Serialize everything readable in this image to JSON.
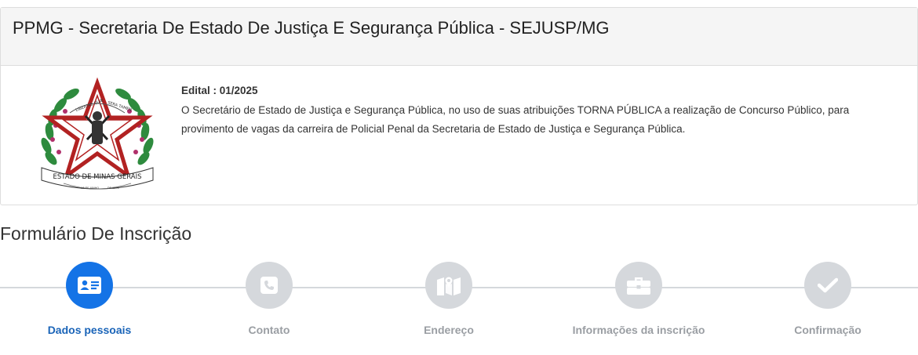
{
  "panel": {
    "title": "PPMG - Secretaria De Estado De Justiça E Segurança Pública - SEJUSP/MG",
    "crest": {
      "banner_top_left": "LIBERTAS QUÆ",
      "banner_top_right": "SERA TAMEN",
      "banner_bottom": "ESTADO DE MINAS GERAIS",
      "ribbon_left": "16 DE JUNHO",
      "ribbon_right": "DE 1891"
    },
    "edital_label": "Edital : 01/2025",
    "edital_text": "O Secretário de Estado de Justiça e Segurança Pública, no uso de suas atribuições TORNA PÚBLICA a realização de Concurso Público, para provimento de vagas da carreira de Policial Penal da Secretaria de Estado de Justiça e Segurança Pública."
  },
  "form": {
    "title": "Formulário De Inscrição"
  },
  "steps": [
    {
      "label": "Dados pessoais",
      "icon": "id-card-icon",
      "state": "active"
    },
    {
      "label": "Contato",
      "icon": "phone-icon",
      "state": "inactive"
    },
    {
      "label": "Endereço",
      "icon": "map-icon",
      "state": "inactive"
    },
    {
      "label": "Informações da inscrição",
      "icon": "briefcase-icon",
      "state": "inactive"
    },
    {
      "label": "Confirmação",
      "icon": "check-icon",
      "state": "inactive"
    }
  ],
  "colors": {
    "active": "#1473e6",
    "active_label": "#1a64b8",
    "inactive": "#d5d8dc",
    "inactive_label": "#9a9ea3"
  }
}
